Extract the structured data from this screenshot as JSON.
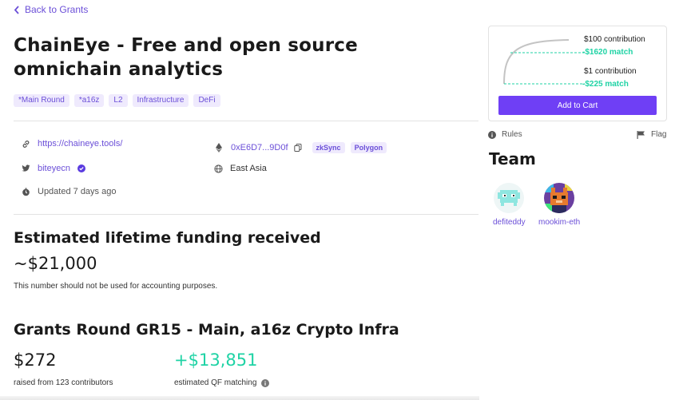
{
  "nav": {
    "back_label": "Back to Grants"
  },
  "project": {
    "title": "ChainEye - Free and open source omnichain analytics",
    "tags": [
      "*Main Round",
      "*a16z",
      "L2",
      "Infrastructure",
      "DeFi"
    ],
    "website": "https://chaineye.tools/",
    "twitter": "biteyecn",
    "updated": "Updated 7 days ago",
    "address": "0xE6D7...9D0f",
    "chains": [
      "zkSync",
      "Polygon"
    ],
    "region": "East Asia"
  },
  "funding": {
    "heading": "Estimated lifetime funding received",
    "amount": "~$21,000",
    "note": "This number should not be used for accounting purposes."
  },
  "round": {
    "heading": "Grants Round GR15 - Main, a16z Crypto Infra",
    "raised": "$272",
    "raised_caption": "raised from 123 contributors",
    "matching": "+$13,851",
    "matching_caption": "estimated QF matching"
  },
  "card": {
    "contrib_high": "$100 contribution",
    "match_high": "-$1620 match",
    "contrib_low": "$1 contribution",
    "match_low": "-$225 match",
    "add_to_cart": "Add to Cart"
  },
  "sidebar": {
    "rules_label": "Rules",
    "flag_label": "Flag"
  },
  "team": {
    "title": "Team",
    "members": [
      {
        "name": "defiteddy"
      },
      {
        "name": "mookim-eth"
      }
    ]
  },
  "colors": {
    "accent": "#6b4fd8",
    "button": "#6f3ff5",
    "match": "#1fd3a5",
    "tag_bg": "#efeafd"
  },
  "icons": [
    "chevron-left-icon",
    "link-icon",
    "twitter-icon",
    "verified-icon",
    "clock-icon",
    "ethereum-icon",
    "copy-icon",
    "globe-icon",
    "info-icon",
    "flag-icon"
  ]
}
